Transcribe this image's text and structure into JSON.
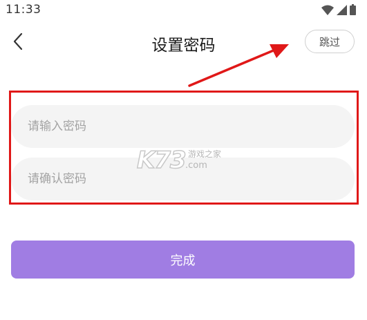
{
  "status_bar": {
    "time": "11:33",
    "icons": [
      "wifi-icon",
      "cellular-signal-icon",
      "battery-icon"
    ]
  },
  "header": {
    "title": "设置密码",
    "back_icon": "chevron-left-icon",
    "skip_label": "跳过"
  },
  "form": {
    "password_placeholder": "请输入密码",
    "password_value": "",
    "confirm_placeholder": "请确认密码",
    "confirm_value": ""
  },
  "submit_label": "完成",
  "watermark": {
    "logo": "K73",
    "tagline": "游戏之家",
    "domain": ".com"
  },
  "colors": {
    "accent": "#a07de3",
    "annotation": "#e01818",
    "field_bg": "#f4f4f4",
    "placeholder": "#a3a3a3"
  }
}
